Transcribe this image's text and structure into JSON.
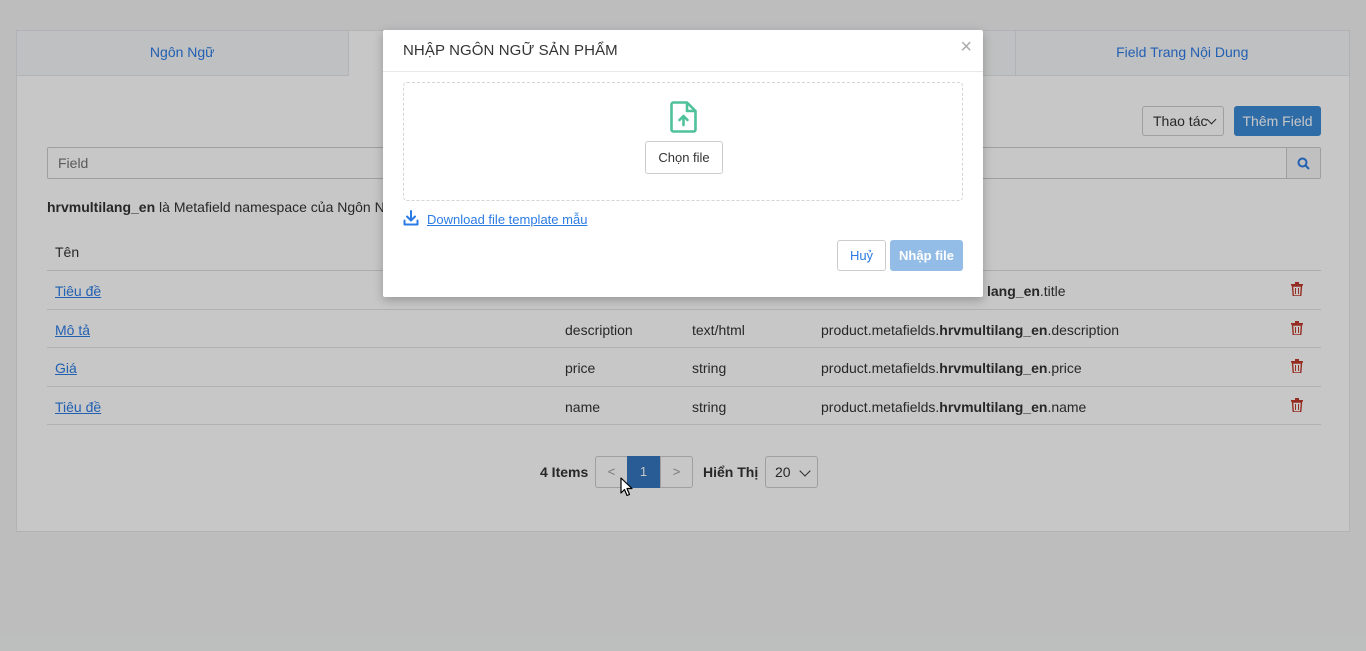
{
  "tabs": [
    {
      "label": "Ngôn Ngữ"
    },
    {
      "label": ""
    },
    {
      "label": ""
    },
    {
      "label": "Field Trang Nội Dung"
    }
  ],
  "toolbar": {
    "actions_label": "Thao tác",
    "add_label": "Thêm Field"
  },
  "search": {
    "placeholder": "Field"
  },
  "namespace": {
    "name": "hrvmultilang_en",
    "suffix": " là Metafield namespace của Ngôn Ngữ"
  },
  "table": {
    "header_name": "Tên",
    "rows": [
      {
        "name": "Tiêu đề",
        "key": "",
        "type": "",
        "ref_prefix": "",
        "ref_bold": "lang_en",
        "ref_suffix": ".title"
      },
      {
        "name": "Mô tả",
        "key": "description",
        "type": "text/html",
        "ref_prefix": "product.metafields.",
        "ref_bold": "hrvmultilang_en",
        "ref_suffix": ".description"
      },
      {
        "name": "Giá",
        "key": "price",
        "type": "string",
        "ref_prefix": "product.metafields.",
        "ref_bold": "hrvmultilang_en",
        "ref_suffix": ".price"
      },
      {
        "name": "Tiêu đề",
        "key": "name",
        "type": "string",
        "ref_prefix": "product.metafields.",
        "ref_bold": "hrvmultilang_en",
        "ref_suffix": ".name"
      }
    ]
  },
  "pager": {
    "items": "4 Items",
    "prev": "<",
    "current": "1",
    "next": ">",
    "show_label": "Hiển Thị",
    "page_size": "20"
  },
  "modal": {
    "title": "NHẬP NGÔN NGỮ SẢN PHẨM",
    "close": "×",
    "choose_file": "Chọn file",
    "download_link": "Download file template mẫu",
    "cancel": "Huỷ",
    "import": "Nhập file"
  },
  "colors": {
    "accent": "#2c7be5",
    "primary_button": "#3b8bd8",
    "import_disabled": "#93bde6",
    "delete_icon": "#c0392b",
    "upload_icon": "#4fc19b"
  }
}
